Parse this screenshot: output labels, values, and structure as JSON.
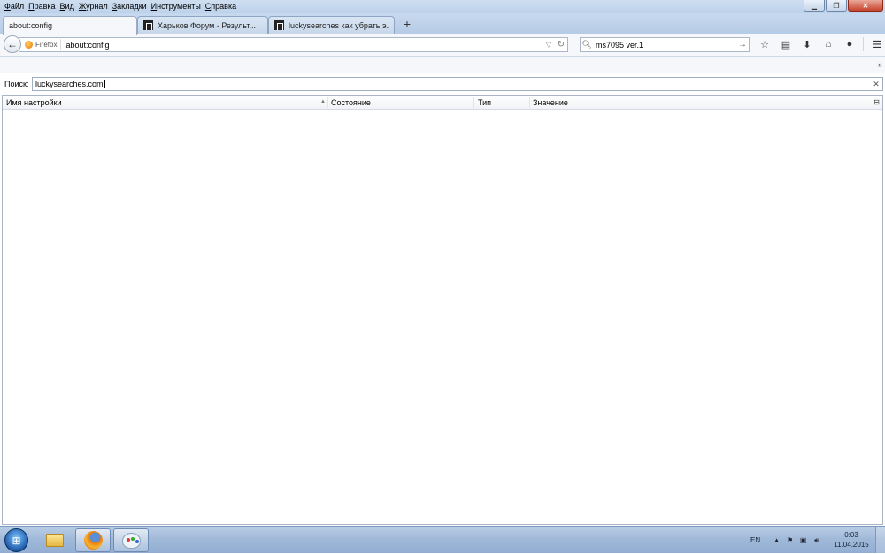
{
  "menu": [
    "Файл",
    "Правка",
    "Вид",
    "Журнал",
    "Закладки",
    "Инструменты",
    "Справка"
  ],
  "tabs": [
    {
      "label": "about:config",
      "active": true
    },
    {
      "label": "Харьков Форум - Результ...",
      "active": false
    },
    {
      "label": "luckysearches как убрать э...",
      "active": false
    }
  ],
  "urlbar": {
    "identity": "Firefox",
    "url": "about:config"
  },
  "searchbar": {
    "value": "ms7095 ver.1"
  },
  "toolbar": {
    "icons": [
      "star-icon",
      "reading-list-icon",
      "download-icon",
      "home-icon",
      "chat-icon",
      "menu-icon"
    ]
  },
  "bookmarks": {
    "overflow": "»"
  },
  "config": {
    "filter_label": "Поиск:",
    "filter_value": "luckysearches.com",
    "columns": {
      "name": "Имя настройки",
      "status": "Состояние",
      "type": "Тип",
      "value": "Значение"
    }
  },
  "taskbar": {
    "lang": "EN",
    "time": "0:03",
    "date": "11.04.2015"
  },
  "colors": {
    "accent": "#b6cbe5",
    "taskbar": "#9fb8d8"
  }
}
